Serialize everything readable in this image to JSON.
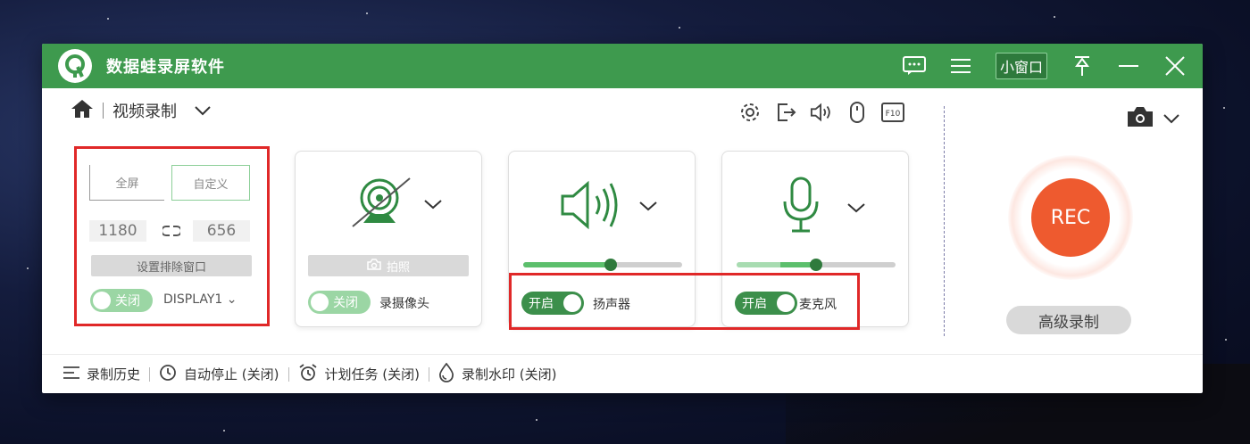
{
  "app": {
    "title": "数据蛙录屏软件",
    "accent": "#3e9a4e",
    "rec_color": "#ee5a2f",
    "highlight": "#e02828"
  },
  "titlebar": {
    "mini_window": "小窗口"
  },
  "nav": {
    "mode": "视频录制"
  },
  "screen_card": {
    "fullscreen": "全屏",
    "custom": "自定义",
    "width": "1180",
    "height": "656",
    "exclude_window": "设置排除窗口",
    "toggle": "关闭",
    "display": "DISPLAY1 ⌄"
  },
  "camera_card": {
    "snapshot": "拍照",
    "toggle": "关闭",
    "label": "录摄像头"
  },
  "speaker_card": {
    "toggle": "开启",
    "label": "扬声器",
    "volume": 0.55
  },
  "mic_card": {
    "toggle": "开启",
    "label": "麦克风",
    "volume": 0.5
  },
  "rec": {
    "label": "REC",
    "advanced": "高级录制"
  },
  "footer": {
    "history": "录制历史",
    "auto_stop": "自动停止 (关闭)",
    "schedule": "计划任务 (关闭)",
    "watermark": "录制水印 (关闭)"
  }
}
